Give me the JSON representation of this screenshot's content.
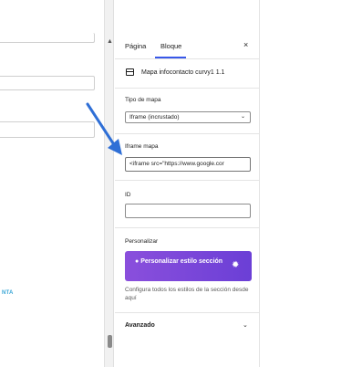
{
  "canvas": {
    "truncated_link": "NTA"
  },
  "tabs": {
    "page": "Página",
    "block": "Bloque",
    "close": "×"
  },
  "block": {
    "icon": "calendar-icon",
    "title": "Mapa infocontacto curvy1 1.1"
  },
  "fields": {
    "map_type": {
      "label": "Tipo de mapa",
      "value": "Iframe (incrustado)"
    },
    "iframe": {
      "label": "Iframe mapa",
      "value": "<iframe src=\"https://www.google.cor"
    },
    "id": {
      "label": "ID",
      "value": ""
    }
  },
  "customize": {
    "label": "Personalizar",
    "button": "Personalizar estilo sección",
    "help": "Configura todos los estilos de la sección desde aquí"
  },
  "advanced": {
    "label": "Avanzado"
  },
  "colors": {
    "accent": "#3858e9",
    "button": "#7a45d8",
    "arrow": "#2f6fd6"
  }
}
